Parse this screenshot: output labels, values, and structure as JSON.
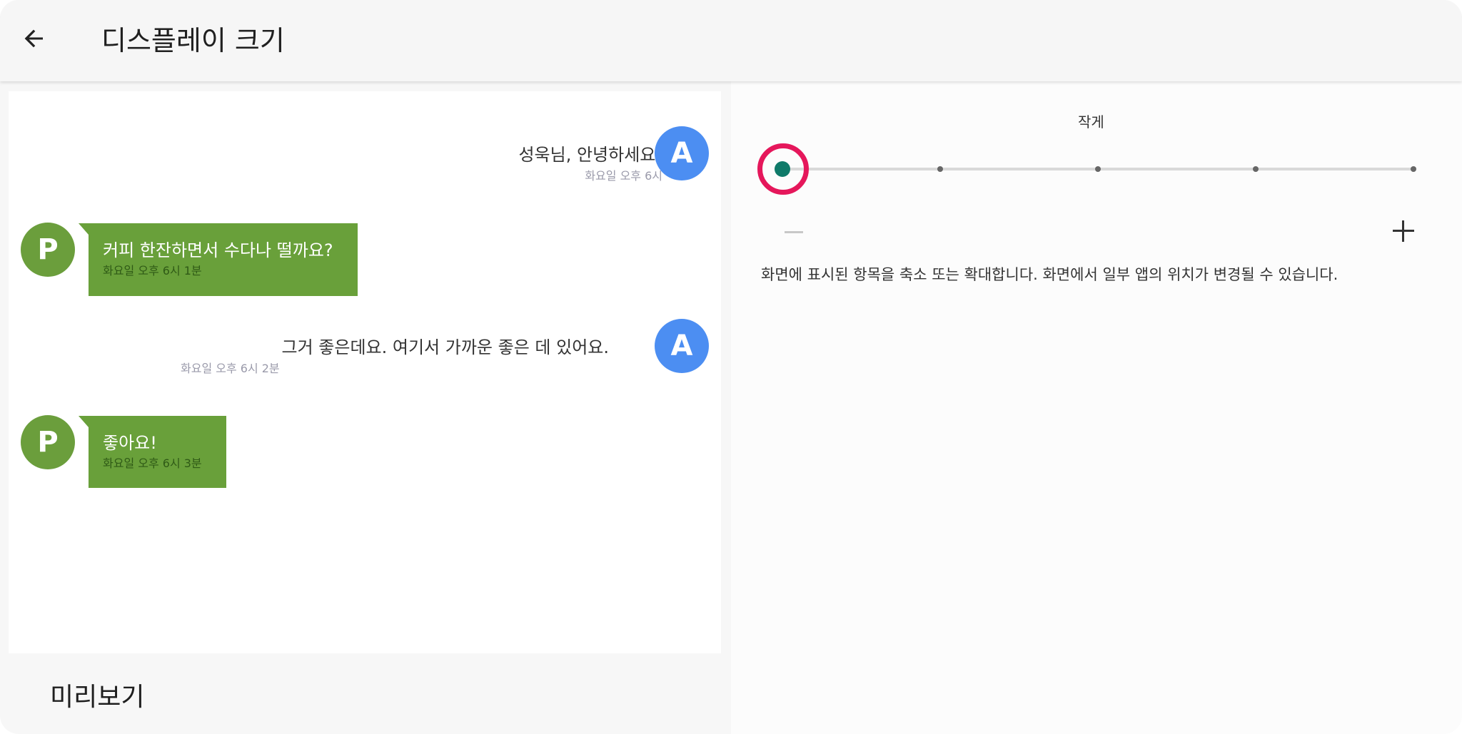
{
  "appbar": {
    "title": "디스플레이 크기",
    "back_icon": "arrow-left-icon"
  },
  "preview": {
    "label": "미리보기",
    "messages": [
      {
        "sender": "A",
        "side": "right",
        "text": "성욱님, 안녕하세요!",
        "time": "화요일 오후 6시"
      },
      {
        "sender": "P",
        "side": "left",
        "text": "커피 한잔하면서 수다나 떨까요?",
        "time": "화요일 오후 6시 1분"
      },
      {
        "sender": "A",
        "side": "right",
        "text": "그거 좋은데요. 여기서 가까운 좋은 데 있어요.",
        "time": "화요일 오후 6시 2분"
      },
      {
        "sender": "P",
        "side": "left",
        "text": "좋아요!",
        "time": "화요일 오후 6시 3분"
      }
    ]
  },
  "settings": {
    "size_label": "작게",
    "slider": {
      "steps": 5,
      "selected_index": 0
    },
    "description": "화면에 표시된 항목을 축소 또는 확대합니다. 화면에서 일부 앱의 위치가 변경될 수 있습니다."
  },
  "colors": {
    "avatar_a": "#4c8ef2",
    "avatar_p": "#6b9e3c",
    "bubble": "#69a03a",
    "slider_thumb": "#0f7a69",
    "highlight_ring": "#e5175b"
  }
}
